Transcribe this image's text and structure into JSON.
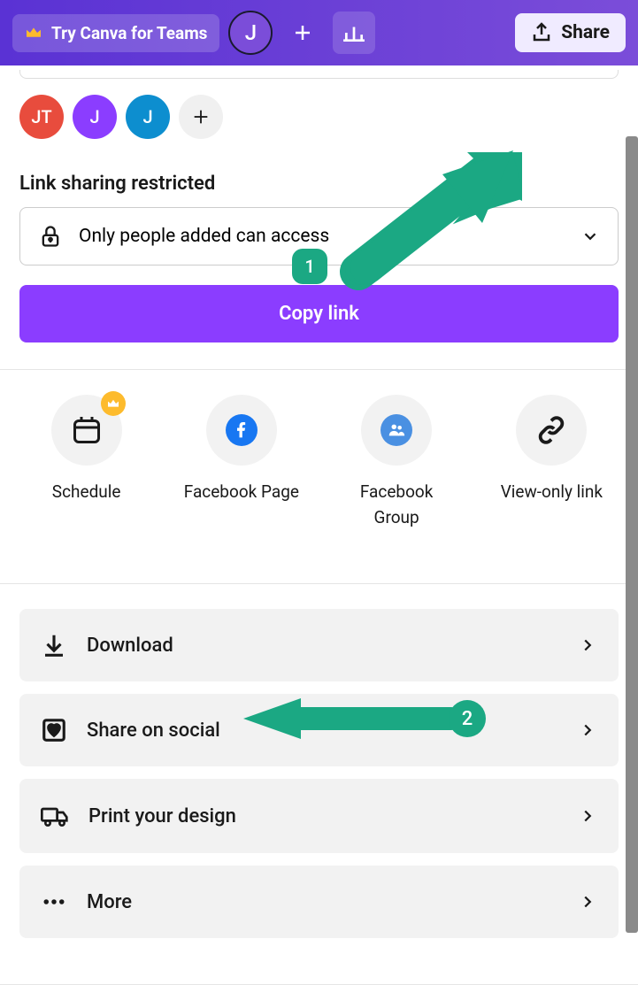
{
  "header": {
    "teams_label": "Try Canva for Teams",
    "avatar_initial": "J",
    "share_label": "Share"
  },
  "avatars": [
    {
      "initials": "JT",
      "color": "red"
    },
    {
      "initials": "J",
      "color": "purple"
    },
    {
      "initials": "J",
      "color": "blue"
    }
  ],
  "link_sharing": {
    "title": "Link sharing restricted",
    "access_label": "Only people added can access",
    "copy_button": "Copy link"
  },
  "share_options": [
    {
      "label": "Schedule",
      "icon": "calendar",
      "badge": "crown"
    },
    {
      "label": "Facebook Page",
      "icon": "facebook-page"
    },
    {
      "label": "Facebook\nGroup",
      "icon": "facebook-group"
    },
    {
      "label": "View-only link",
      "icon": "link"
    }
  ],
  "actions": [
    {
      "label": "Download",
      "icon": "download"
    },
    {
      "label": "Share on social",
      "icon": "heart"
    },
    {
      "label": "Print your design",
      "icon": "truck"
    },
    {
      "label": "More",
      "icon": "dots"
    }
  ],
  "annotations": {
    "badge1": "1",
    "badge2": "2"
  },
  "colors": {
    "accent": "#8b3dff",
    "annotation": "#1ba883"
  }
}
